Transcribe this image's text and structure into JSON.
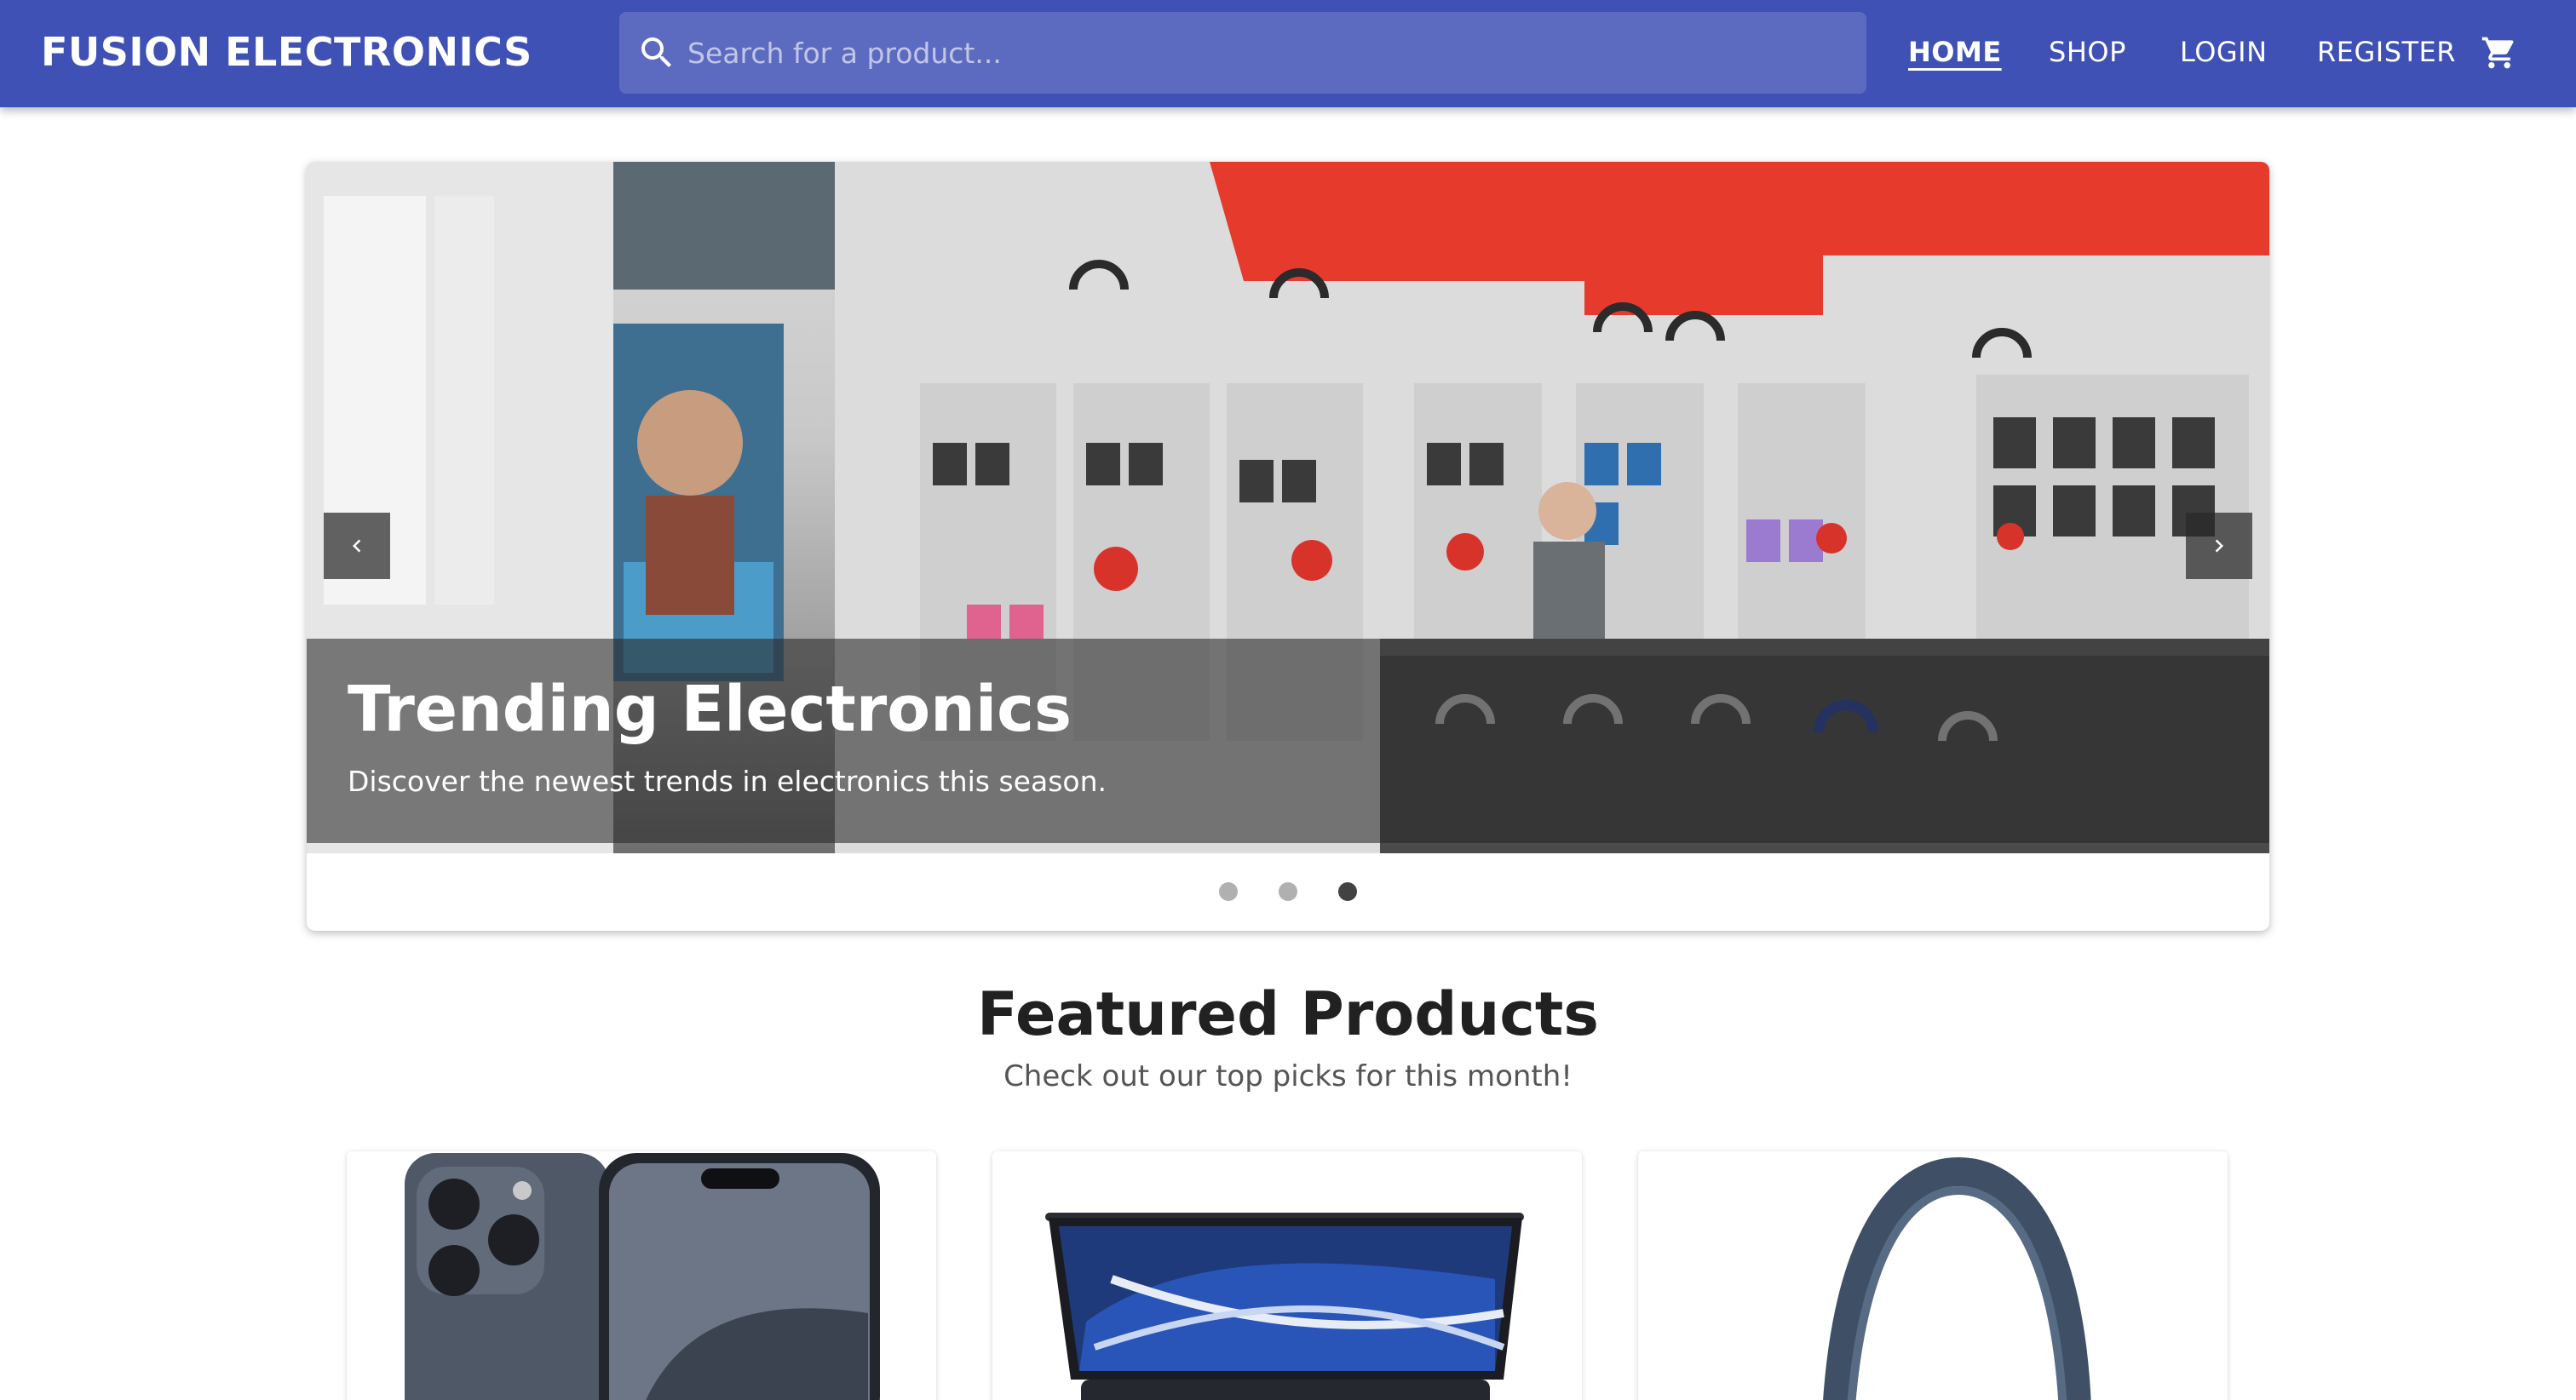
{
  "header": {
    "brand": "FUSION ELECTRONICS",
    "search_placeholder": "Search for a product...",
    "nav": {
      "home": "HOME",
      "shop": "SHOP",
      "login": "LOGIN",
      "register": "REGISTER"
    },
    "bg_color": "#3f51b5",
    "search_bg_color": "#5c6bc0"
  },
  "carousel": {
    "slide": {
      "title": "Trending Electronics",
      "text": "Discover the newest trends in electronics this season.",
      "image": "electronics-store-interior"
    },
    "prev_icon": "chevron-left-icon",
    "next_icon": "chevron-right-icon",
    "slide_count": 3,
    "active_index": 2
  },
  "featured": {
    "title": "Featured Products",
    "subtitle": "Check out our top picks for this month!",
    "products": [
      {
        "image": "smartphone-product-image"
      },
      {
        "image": "laptop-product-image"
      },
      {
        "image": "headphones-product-image"
      }
    ]
  },
  "icons": {
    "search": "search-icon",
    "cart": "cart-icon"
  }
}
